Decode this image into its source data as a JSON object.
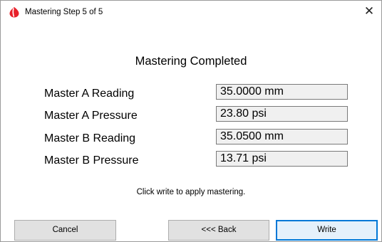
{
  "window": {
    "title": "Mastering Step 5 of 5",
    "close_glyph": "✕",
    "app_icon": "red-drop-logo-icon",
    "accent_color": "#0078d7",
    "icon_color": "#e8202a"
  },
  "main": {
    "heading": "Mastering Completed",
    "rows": [
      {
        "label": "Master A Reading",
        "value": "35.0000 mm"
      },
      {
        "label": "Master A Pressure",
        "value": "23.80 psi"
      },
      {
        "label": "Master B Reading",
        "value": "35.0500 mm"
      },
      {
        "label": "Master B Pressure",
        "value": "13.71 psi"
      }
    ],
    "hint": "Click write to apply mastering."
  },
  "buttons": {
    "cancel": "Cancel",
    "back": "<<< Back",
    "write": "Write"
  }
}
